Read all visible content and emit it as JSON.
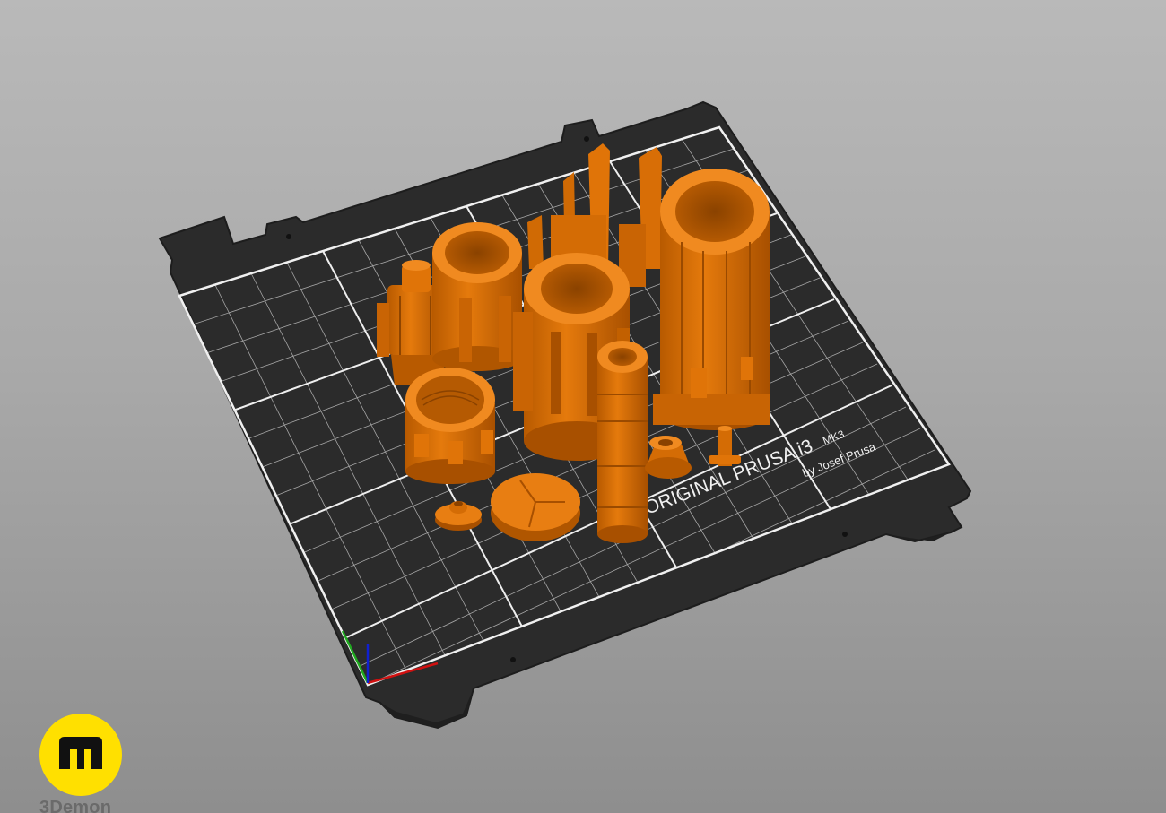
{
  "viewport": {
    "background_color": "#a9a9a9",
    "bed_color": "#2b2b2b",
    "grid_color": "#d9d9d9",
    "part_color": "#d96f06"
  },
  "bed": {
    "brand_main": "ORIGINAL PRUSA i3",
    "brand_model": "MK3",
    "brand_sub": "by Josef Prusa"
  },
  "axes": {
    "x_color": "#d01010",
    "y_color": "#1fa81f",
    "z_color": "#1020d0"
  },
  "logo": {
    "icon": "3demon-logo-icon",
    "text": "3Demon",
    "color": "#ffe000"
  }
}
